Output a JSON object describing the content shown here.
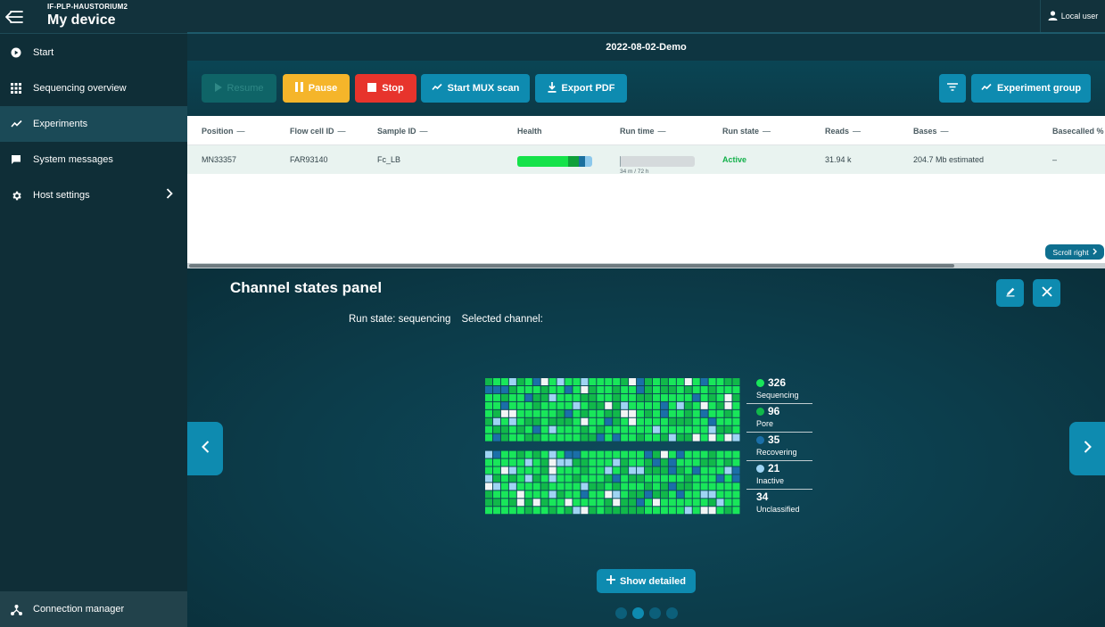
{
  "header": {
    "device_subtitle": "IF-PLP-HAUSTORIUM2",
    "device_title": "My device",
    "user_label": "Local user",
    "experiment_title": "2022-08-02-Demo"
  },
  "sidebar": {
    "items": [
      {
        "label": "Start",
        "icon": "play-circle-icon"
      },
      {
        "label": "Sequencing overview",
        "icon": "grid-icon"
      },
      {
        "label": "Experiments",
        "icon": "trend-icon",
        "active": true
      },
      {
        "label": "System messages",
        "icon": "message-icon"
      },
      {
        "label": "Host settings",
        "icon": "gear-icon",
        "chevron": true
      }
    ],
    "connection_manager": "Connection manager"
  },
  "toolbar": {
    "resume": "Resume",
    "pause": "Pause",
    "stop": "Stop",
    "mux_scan": "Start MUX scan",
    "export_pdf": "Export PDF",
    "experiment_group": "Experiment group"
  },
  "table": {
    "headers": [
      "Position",
      "Flow cell ID",
      "Sample ID",
      "Health",
      "Run time",
      "Run state",
      "Reads",
      "Bases",
      "Basecalled %"
    ],
    "row": {
      "position": "MN33357",
      "flow_cell_id": "FAR93140",
      "sample_id": "Fc_LB",
      "health_segments": [
        {
          "fraction": 0.68,
          "color": "#15e24a"
        },
        {
          "fraction": 0.14,
          "color": "#0fa03a"
        },
        {
          "fraction": 0.09,
          "color": "#1a6f9e"
        },
        {
          "fraction": 0.09,
          "color": "#8cc8ec"
        }
      ],
      "runtime_fraction": 0.008,
      "runtime_label": "34 m / 72 h",
      "run_state": "Active",
      "reads": "31.94 k",
      "bases": "204.7 Mb estimated",
      "basecalled": "–"
    },
    "scroll_right": "Scroll right"
  },
  "panel": {
    "title": "Channel states panel",
    "run_state": "Run state: sequencing",
    "selected_channel": "Selected channel:",
    "show_detailed": "Show detailed",
    "legend": [
      {
        "count": "326",
        "name": "Sequencing",
        "color": "#19e65a"
      },
      {
        "count": "96",
        "name": "Pore",
        "color": "#11b84a"
      },
      {
        "count": "35",
        "name": "Recovering",
        "color": "#1b6fa8"
      },
      {
        "count": "21",
        "name": "Inactive",
        "color": "#9fd4f3"
      },
      {
        "count": "34",
        "name": "Unclassified",
        "color": ""
      }
    ],
    "grid": {
      "columns": 32,
      "rows_per_block": 8,
      "blocks": 2,
      "colors": {
        "seq": "#19e65a",
        "pore": "#11b84a",
        "rec": "#1b6fa8",
        "inact": "#9fd4f3",
        "uncl": "#f2f5f5"
      }
    },
    "pager": {
      "count": 4,
      "active": 1
    }
  }
}
